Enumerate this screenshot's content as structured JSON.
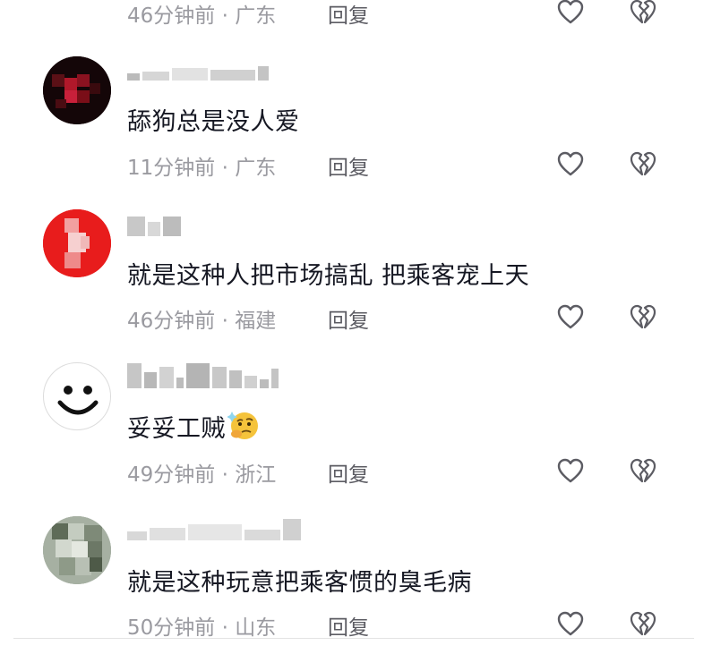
{
  "reply_label": "回复",
  "comments": [
    {
      "time_location": "46分钟前 · 广东",
      "content": ""
    },
    {
      "time_location": "11分钟前 · 广东",
      "content": "舔狗总是没人爱"
    },
    {
      "time_location": "46分钟前 · 福建",
      "content": "就是这种人把市场搞乱 把乘客宠上天"
    },
    {
      "time_location": "49分钟前 · 浙江",
      "content": "妥妥工贼",
      "emoji": "thinking-face-emoji"
    },
    {
      "time_location": "50分钟前 · 山东",
      "content": "就是这种玩意把乘客惯的臭毛病"
    }
  ],
  "icons": {
    "like": "heart-outline-icon",
    "dislike": "broken-heart-icon"
  },
  "colors": {
    "primary_text": "#161823",
    "meta_text": "#9a9aa0",
    "icon": "#5c5c63"
  }
}
